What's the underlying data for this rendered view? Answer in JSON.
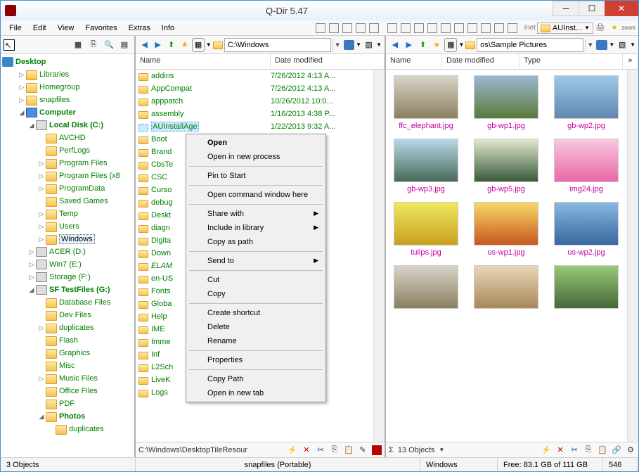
{
  "window": {
    "title": "Q-Dir 5.47"
  },
  "menubar": {
    "items": [
      "File",
      "Edit",
      "View",
      "Favorites",
      "Extras",
      "Info"
    ],
    "tab_label": "AUInst..."
  },
  "tree": {
    "root": "Desktop",
    "items": [
      {
        "label": "Libraries",
        "indent": 1,
        "exp": "▷",
        "icon": "lib"
      },
      {
        "label": "Homegroup",
        "indent": 1,
        "exp": "▷",
        "icon": "home"
      },
      {
        "label": "snapfiles",
        "indent": 1,
        "exp": "▷",
        "icon": "folder"
      },
      {
        "label": "Computer",
        "indent": 1,
        "exp": "◢",
        "icon": "comp",
        "bold": true
      },
      {
        "label": "Local Disk (C:)",
        "indent": 2,
        "exp": "◢",
        "icon": "drive",
        "bold": true
      },
      {
        "label": "AVCHD",
        "indent": 3,
        "exp": "",
        "icon": "folder"
      },
      {
        "label": "PerfLogs",
        "indent": 3,
        "exp": "",
        "icon": "folder"
      },
      {
        "label": "Program Files",
        "indent": 3,
        "exp": "▷",
        "icon": "folder"
      },
      {
        "label": "Program Files (x8",
        "indent": 3,
        "exp": "▷",
        "icon": "folder"
      },
      {
        "label": "ProgramData",
        "indent": 3,
        "exp": "▷",
        "icon": "folder"
      },
      {
        "label": "Saved Games",
        "indent": 3,
        "exp": "",
        "icon": "folder"
      },
      {
        "label": "Temp",
        "indent": 3,
        "exp": "▷",
        "icon": "folder"
      },
      {
        "label": "Users",
        "indent": 3,
        "exp": "▷",
        "icon": "folder"
      },
      {
        "label": "Windows",
        "indent": 3,
        "exp": "▷",
        "icon": "folder",
        "selected": true,
        "green": false
      },
      {
        "label": "ACER (D:)",
        "indent": 2,
        "exp": "▷",
        "icon": "drive"
      },
      {
        "label": "Win7 (E:)",
        "indent": 2,
        "exp": "▷",
        "icon": "drive"
      },
      {
        "label": "Storage (F:)",
        "indent": 2,
        "exp": "▷",
        "icon": "drive"
      },
      {
        "label": "SF TestFiles (G:)",
        "indent": 2,
        "exp": "◢",
        "icon": "drive",
        "bold": true
      },
      {
        "label": "Database Files",
        "indent": 3,
        "exp": "",
        "icon": "folder"
      },
      {
        "label": "Dev Files",
        "indent": 3,
        "exp": "",
        "icon": "folder"
      },
      {
        "label": "duplicates",
        "indent": 3,
        "exp": "▷",
        "icon": "folder"
      },
      {
        "label": "Flash",
        "indent": 3,
        "exp": "",
        "icon": "folder"
      },
      {
        "label": "Graphics",
        "indent": 3,
        "exp": "",
        "icon": "folder"
      },
      {
        "label": "Misc",
        "indent": 3,
        "exp": "",
        "icon": "folder"
      },
      {
        "label": "Music Files",
        "indent": 3,
        "exp": "▷",
        "icon": "folder"
      },
      {
        "label": "Office Files",
        "indent": 3,
        "exp": "",
        "icon": "folder"
      },
      {
        "label": "PDF",
        "indent": 3,
        "exp": "",
        "icon": "folder"
      },
      {
        "label": "Photos",
        "indent": 3,
        "exp": "◢",
        "icon": "folder",
        "bold": true
      },
      {
        "label": "duplicates",
        "indent": 4,
        "exp": "",
        "icon": "folder"
      }
    ]
  },
  "midpane": {
    "address": "C:\\Windows",
    "cols": {
      "name": "Name",
      "date": "Date modified"
    },
    "files": [
      {
        "n": "addins",
        "d": "7/26/2012 4:13 A..."
      },
      {
        "n": "AppCompat",
        "d": "7/26/2012 4:13 A..."
      },
      {
        "n": "apppatch",
        "d": "10/26/2012 10:0..."
      },
      {
        "n": "assembly",
        "d": "1/16/2013 4:38 P..."
      },
      {
        "n": "AUInstallAge",
        "d": "1/22/2013 9:32 A...",
        "sel": true
      },
      {
        "n": "Boot",
        "d": ""
      },
      {
        "n": "Brand",
        "d": ""
      },
      {
        "n": "CbsTe",
        "d": ""
      },
      {
        "n": "CSC",
        "d": ""
      },
      {
        "n": "Curso",
        "d": ""
      },
      {
        "n": "debug",
        "d": ""
      },
      {
        "n": "Deskt",
        "d": ""
      },
      {
        "n": "diagn",
        "d": ""
      },
      {
        "n": "Digita",
        "d": ""
      },
      {
        "n": "Down",
        "d": ""
      },
      {
        "n": "ELAM",
        "d": "",
        "italic": true
      },
      {
        "n": "en-US",
        "d": ""
      },
      {
        "n": "Fonts",
        "d": ""
      },
      {
        "n": "Globa",
        "d": ""
      },
      {
        "n": "Help",
        "d": ""
      },
      {
        "n": "IME",
        "d": ""
      },
      {
        "n": "Imme",
        "d": ""
      },
      {
        "n": "Inf",
        "d": ""
      },
      {
        "n": "L2Sch",
        "d": ""
      },
      {
        "n": "LiveK",
        "d": ""
      },
      {
        "n": "Logs",
        "d": ""
      }
    ],
    "status_path": "C:\\Windows\\DesktopTileResour"
  },
  "rightpane": {
    "address": "os\\Sample Pictures",
    "cols": {
      "name": "Name",
      "date": "Date modified",
      "type": "Type"
    },
    "thumbs": [
      {
        "label": "ffc_elephant.jpg",
        "cls": "ph1"
      },
      {
        "label": "gb-wp1.jpg",
        "cls": "ph2"
      },
      {
        "label": "gb-wp2.jpg",
        "cls": "ph3"
      },
      {
        "label": "gb-wp3.jpg",
        "cls": "ph4"
      },
      {
        "label": "gb-wp5.jpg",
        "cls": "ph5"
      },
      {
        "label": "img24.jpg",
        "cls": "ph6"
      },
      {
        "label": "tulips.jpg",
        "cls": "ph7"
      },
      {
        "label": "us-wp1.jpg",
        "cls": "ph8"
      },
      {
        "label": "us-wp2.jpg",
        "cls": "ph9"
      },
      {
        "label": "",
        "cls": "ph10"
      },
      {
        "label": "",
        "cls": "ph11"
      },
      {
        "label": "",
        "cls": "ph12"
      }
    ],
    "status_count": "13 Objects"
  },
  "context_menu": {
    "groups": [
      [
        {
          "l": "Open",
          "bold": true
        },
        {
          "l": "Open in new process"
        }
      ],
      [
        {
          "l": "Pin to Start"
        }
      ],
      [
        {
          "l": "Open command window here"
        }
      ],
      [
        {
          "l": "Share with",
          "sub": true
        },
        {
          "l": "Include in library",
          "sub": true
        },
        {
          "l": "Copy as path"
        }
      ],
      [
        {
          "l": "Send to",
          "sub": true
        }
      ],
      [
        {
          "l": "Cut"
        },
        {
          "l": "Copy"
        }
      ],
      [
        {
          "l": "Create shortcut"
        },
        {
          "l": "Delete"
        },
        {
          "l": "Rename"
        }
      ],
      [
        {
          "l": "Properties"
        }
      ],
      [
        {
          "l": "Copy Path"
        },
        {
          "l": "Open in new tab"
        }
      ]
    ]
  },
  "statusbar": {
    "left": "3 Objects",
    "mid": "snapfiles (Portable)",
    "r1": "Windows",
    "r2": "Free: 83.1 GB of 111 GB",
    "r3": "546"
  }
}
